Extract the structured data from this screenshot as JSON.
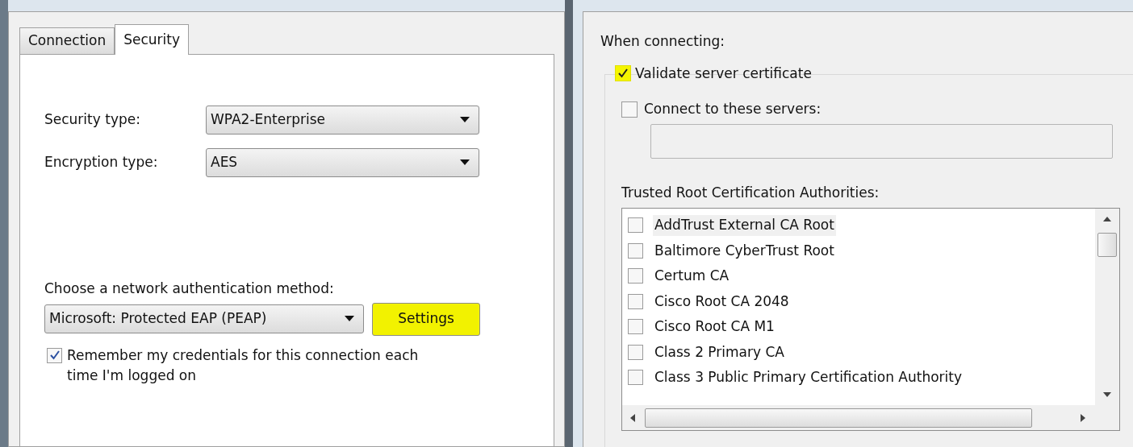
{
  "left_dialog": {
    "tabs": [
      {
        "label": "Connection",
        "selected": false
      },
      {
        "label": "Security",
        "selected": true
      }
    ],
    "security_type": {
      "label": "Security type:",
      "value": "WPA2-Enterprise"
    },
    "encryption_type": {
      "label": "Encryption type:",
      "value": "AES"
    },
    "auth_method": {
      "label": "Choose a network authentication method:",
      "value": "Microsoft: Protected EAP (PEAP)"
    },
    "settings_button": {
      "label": "Settings",
      "highlighted": true
    },
    "remember": {
      "label": "Remember my credentials for this connection each time I'm logged on",
      "checked": true
    }
  },
  "right_dialog": {
    "heading": "When connecting:",
    "validate": {
      "label": "Validate server certificate",
      "checked": true,
      "highlighted": true
    },
    "connect_servers": {
      "label": "Connect to these servers:",
      "checked": false
    },
    "trusted_label": "Trusted Root Certification Authorities:",
    "authorities": [
      {
        "name": "AddTrust External CA Root",
        "checked": false,
        "selected": true
      },
      {
        "name": "Baltimore CyberTrust Root",
        "checked": false,
        "selected": false
      },
      {
        "name": "Certum CA",
        "checked": false,
        "selected": false
      },
      {
        "name": "Cisco Root CA 2048",
        "checked": false,
        "selected": false
      },
      {
        "name": "Cisco Root CA M1",
        "checked": false,
        "selected": false
      },
      {
        "name": "Class 2 Primary CA",
        "checked": false,
        "selected": false
      },
      {
        "name": "Class 3 Public Primary Certification Authority",
        "checked": false,
        "selected": false
      }
    ]
  }
}
